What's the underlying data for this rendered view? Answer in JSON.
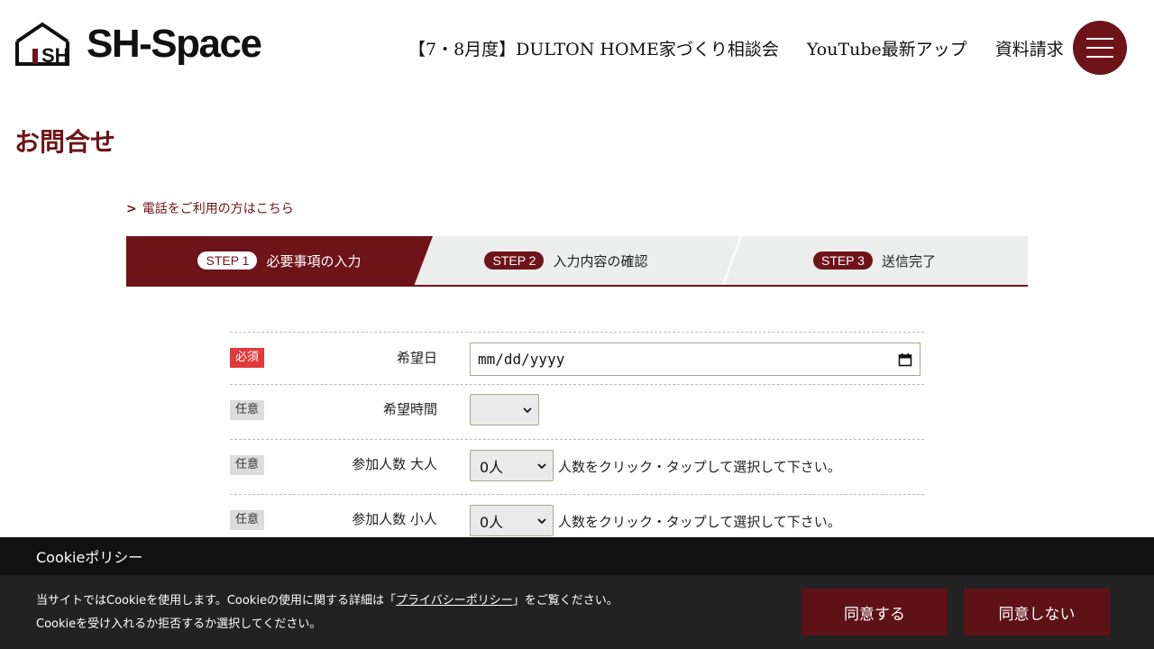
{
  "brand": {
    "name": "SH-Space",
    "accent": "#6e1419"
  },
  "nav": {
    "items": [
      {
        "label": "【7・8月度】DULTON HOME家づくり相談会"
      },
      {
        "label": "YouTube最新アップ"
      },
      {
        "label": "資料請求"
      }
    ],
    "menu_icon": "hamburger-icon"
  },
  "page": {
    "title": "お問合せ"
  },
  "tel_link": {
    "arrow": ">",
    "label": "電話をご利用の方はこちら"
  },
  "steps": [
    {
      "tag": "STEP 1",
      "label": "必要事項の入力",
      "active": true
    },
    {
      "tag": "STEP 2",
      "label": "入力内容の確認",
      "active": false
    },
    {
      "tag": "STEP 3",
      "label": "送信完了",
      "active": false
    }
  ],
  "form": {
    "rows": [
      {
        "badge": "必須",
        "label": "希望日",
        "value": "mm/dd/yyyy"
      },
      {
        "badge": "任意",
        "label": "希望時間",
        "value": ""
      },
      {
        "badge": "任意",
        "label": "参加人数 大人",
        "value": "0人",
        "hint": "人数をクリック・タップして選択して下さい。"
      },
      {
        "badge": "任意",
        "label": "参加人数 小人",
        "value": "0人",
        "hint": "人数をクリック・タップして選択して下さい。"
      }
    ]
  },
  "cookie": {
    "title": "Cookieポリシー",
    "line1_pre": "当サイトではCookieを使用します。Cookieの使用に関する詳細は「",
    "line1_link": "プライバシーポリシー",
    "line1_post": "」をご覧ください。",
    "line2": "Cookieを受け入れるか拒否するか選択してください。",
    "agree": "同意する",
    "disagree": "同意しない"
  }
}
